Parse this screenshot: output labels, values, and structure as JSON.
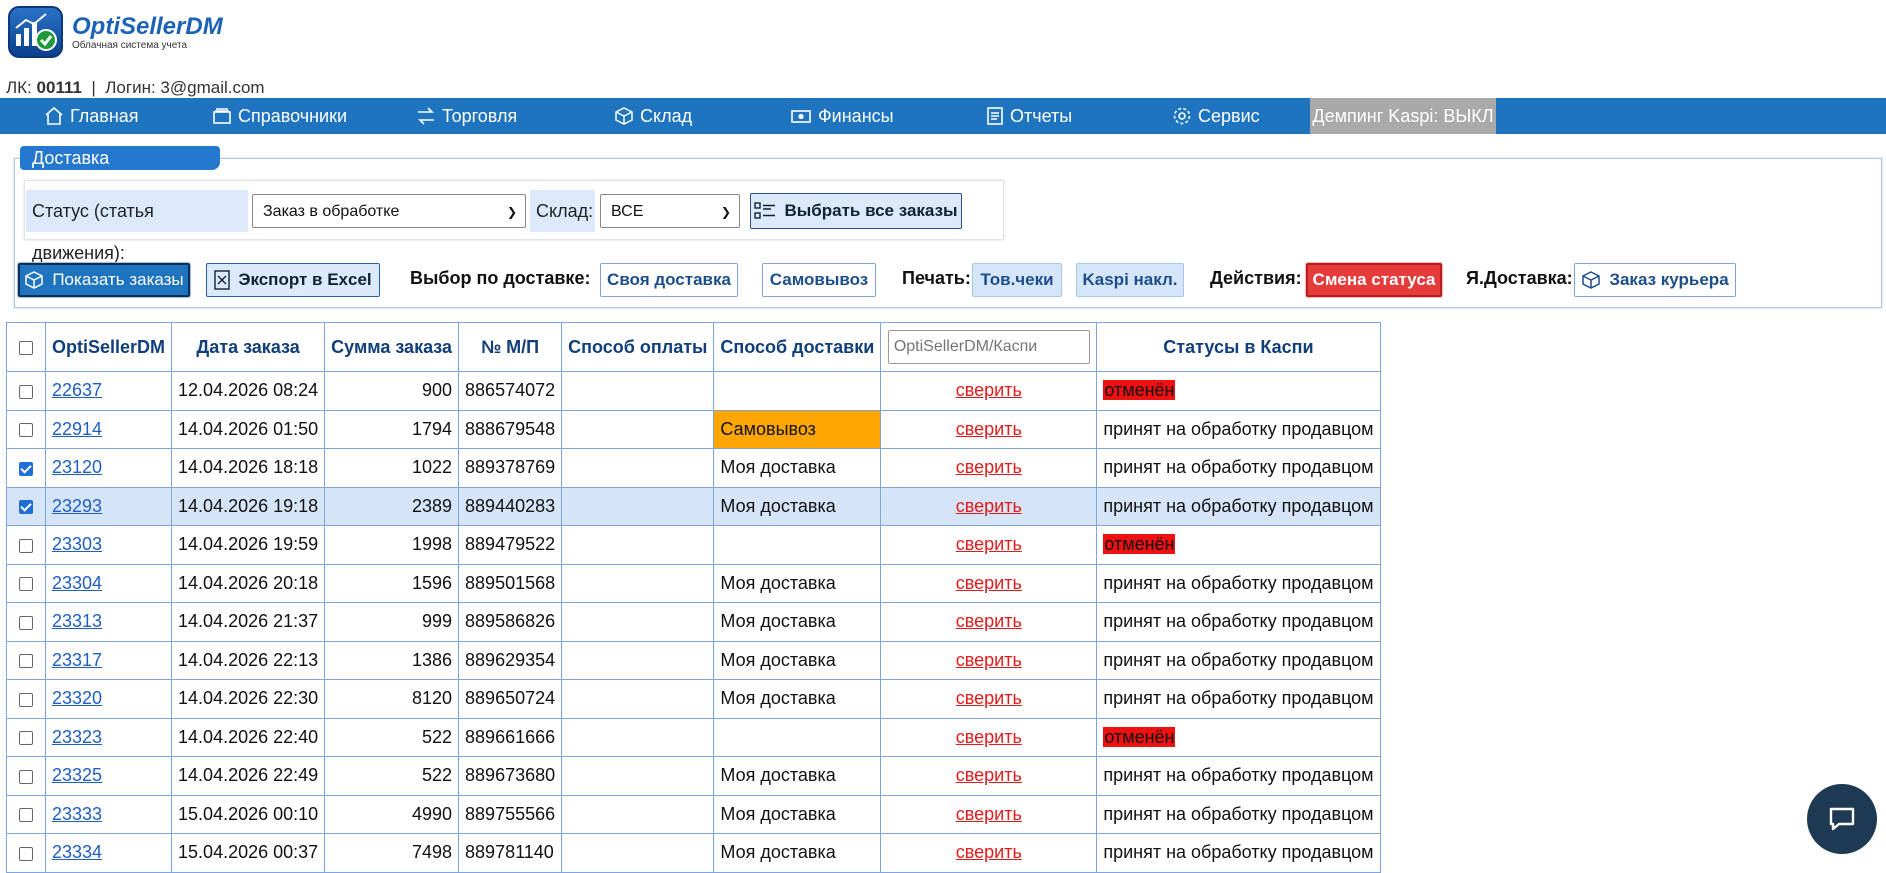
{
  "logo": {
    "title": "OptiSellerDM",
    "subtitle": "Облачная система учета"
  },
  "account": {
    "lk_label": "ЛК:",
    "lk_number": "00111",
    "separator": "|",
    "login_label": "Логин:",
    "login": "3@gmail.com"
  },
  "nav": {
    "items": [
      {
        "label": "Главная",
        "icon": "home-icon"
      },
      {
        "label": "Справочники",
        "icon": "folder-icon"
      },
      {
        "label": "Торговля",
        "icon": "swap-icon"
      },
      {
        "label": "Склад",
        "icon": "box-icon"
      },
      {
        "label": "Финансы",
        "icon": "money-icon"
      },
      {
        "label": "Отчеты",
        "icon": "report-icon"
      },
      {
        "label": "Сервис",
        "icon": "gear-icon"
      }
    ],
    "dumping": "Демпинг Kaspi: ВЫКЛ"
  },
  "panel": {
    "title": "Доставка"
  },
  "filters": {
    "status_label": "Статус (статья движения):",
    "status_value": "Заказ в обработке",
    "warehouse_label": "Склад:",
    "warehouse_value": "ВСЕ",
    "select_all": "Выбрать все заказы"
  },
  "actions": {
    "show_orders": "Показать заказы",
    "export_excel": "Экспорт в Excel",
    "delivery_choice_label": "Выбор по доставке:",
    "own_delivery": "Своя доставка",
    "pickup": "Самовывоз",
    "print_label": "Печать:",
    "receipts": "Тов.чеки",
    "kaspi_invoices": "Kaspi накл.",
    "actions_label": "Действия:",
    "change_status": "Смена статуса",
    "ya_delivery_label": "Я.Доставка:",
    "courier_order": "Заказ курьера"
  },
  "table": {
    "headers": [
      "OptiSellerDM",
      "Дата заказа",
      "Сумма заказа",
      "№ М/П",
      "Способ оплаты",
      "Способ доставки",
      "",
      "Статусы в Каспи"
    ],
    "search_placeholder": "OptiSellerDM/Каспи",
    "verify_label": "сверить",
    "rows": [
      {
        "id": "22637",
        "date": "12.04.2026 08:24",
        "sum": "900",
        "mp": "886574072",
        "payment": "",
        "delivery": "",
        "status": "отменён",
        "checked": false,
        "selected": false
      },
      {
        "id": "22914",
        "date": "14.04.2026 01:50",
        "sum": "1794",
        "mp": "888679548",
        "payment": "",
        "delivery": "Самовывоз",
        "status": "принят на обработку продавцом",
        "checked": false,
        "selected": false
      },
      {
        "id": "23120",
        "date": "14.04.2026 18:18",
        "sum": "1022",
        "mp": "889378769",
        "payment": "",
        "delivery": "Моя доставка",
        "status": "принят на обработку продавцом",
        "checked": true,
        "selected": false
      },
      {
        "id": "23293",
        "date": "14.04.2026 19:18",
        "sum": "2389",
        "mp": "889440283",
        "payment": "",
        "delivery": "Моя доставка",
        "status": "принят на обработку продавцом",
        "checked": true,
        "selected": true
      },
      {
        "id": "23303",
        "date": "14.04.2026 19:59",
        "sum": "1998",
        "mp": "889479522",
        "payment": "",
        "delivery": "",
        "status": "отменён",
        "checked": false,
        "selected": false
      },
      {
        "id": "23304",
        "date": "14.04.2026 20:18",
        "sum": "1596",
        "mp": "889501568",
        "payment": "",
        "delivery": "Моя доставка",
        "status": "принят на обработку продавцом",
        "checked": false,
        "selected": false
      },
      {
        "id": "23313",
        "date": "14.04.2026 21:37",
        "sum": "999",
        "mp": "889586826",
        "payment": "",
        "delivery": "Моя доставка",
        "status": "принят на обработку продавцом",
        "checked": false,
        "selected": false
      },
      {
        "id": "23317",
        "date": "14.04.2026 22:13",
        "sum": "1386",
        "mp": "889629354",
        "payment": "",
        "delivery": "Моя доставка",
        "status": "принят на обработку продавцом",
        "checked": false,
        "selected": false
      },
      {
        "id": "23320",
        "date": "14.04.2026 22:30",
        "sum": "8120",
        "mp": "889650724",
        "payment": "",
        "delivery": "Моя доставка",
        "status": "принят на обработку продавцом",
        "checked": false,
        "selected": false
      },
      {
        "id": "23323",
        "date": "14.04.2026 22:40",
        "sum": "522",
        "mp": "889661666",
        "payment": "",
        "delivery": "",
        "status": "отменён",
        "checked": false,
        "selected": false
      },
      {
        "id": "23325",
        "date": "14.04.2026 22:49",
        "sum": "522",
        "mp": "889673680",
        "payment": "",
        "delivery": "Моя доставка",
        "status": "принят на обработку продавцом",
        "checked": false,
        "selected": false
      },
      {
        "id": "23333",
        "date": "15.04.2026 00:10",
        "sum": "4990",
        "mp": "889755566",
        "payment": "",
        "delivery": "Моя доставка",
        "status": "принят на обработку продавцом",
        "checked": false,
        "selected": false
      },
      {
        "id": "23334",
        "date": "15.04.2026 00:37",
        "sum": "7498",
        "mp": "889781140",
        "payment": "",
        "delivery": "Моя доставка",
        "status": "принят на обработку продавцом",
        "checked": false,
        "selected": false
      }
    ]
  },
  "colors": {
    "nav": "#1f74c0",
    "accent_red": "#e53b3b",
    "pickup_highlight": "#ffa600",
    "cancel_mark": "#ee1111",
    "selected_row": "#d6e4f8"
  }
}
